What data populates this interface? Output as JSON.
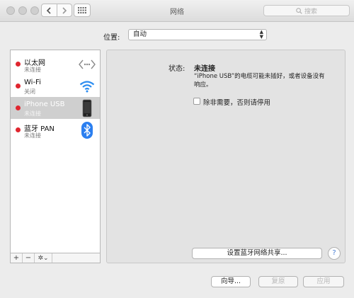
{
  "window": {
    "title": "网络"
  },
  "search": {
    "placeholder": "搜索"
  },
  "location": {
    "label": "位置:",
    "value": "自动"
  },
  "services": [
    {
      "name": "以太网",
      "status": "未连接",
      "icon": "ethernet-icon",
      "selected": false
    },
    {
      "name": "Wi-Fi",
      "status": "关闭",
      "icon": "wifi-icon",
      "selected": false
    },
    {
      "name": "iPhone USB",
      "status": "未连接",
      "icon": "iphone-icon",
      "selected": true
    },
    {
      "name": "蓝牙 PAN",
      "status": "未连接",
      "icon": "bluetooth-icon",
      "selected": false
    }
  ],
  "list_footer": {
    "add": "+",
    "remove": "−",
    "gear": "✲⌄"
  },
  "detail": {
    "status_label": "状态:",
    "status_value": "未连接",
    "status_desc": "“iPhone USB”的电缆可能未插好，或者设备没有响应。",
    "checkbox_label": "除非需要，否则请停用",
    "setup_button": "设置蓝牙网络共享...",
    "help": "?"
  },
  "footer": {
    "assist": "向导...",
    "revert": "复原",
    "apply": "应用"
  },
  "colors": {
    "status_dot": "#e0262f",
    "selected_row": "#cfcfcf",
    "wifi": "#2b8cf0",
    "bluetooth": "#2b7ff0"
  }
}
